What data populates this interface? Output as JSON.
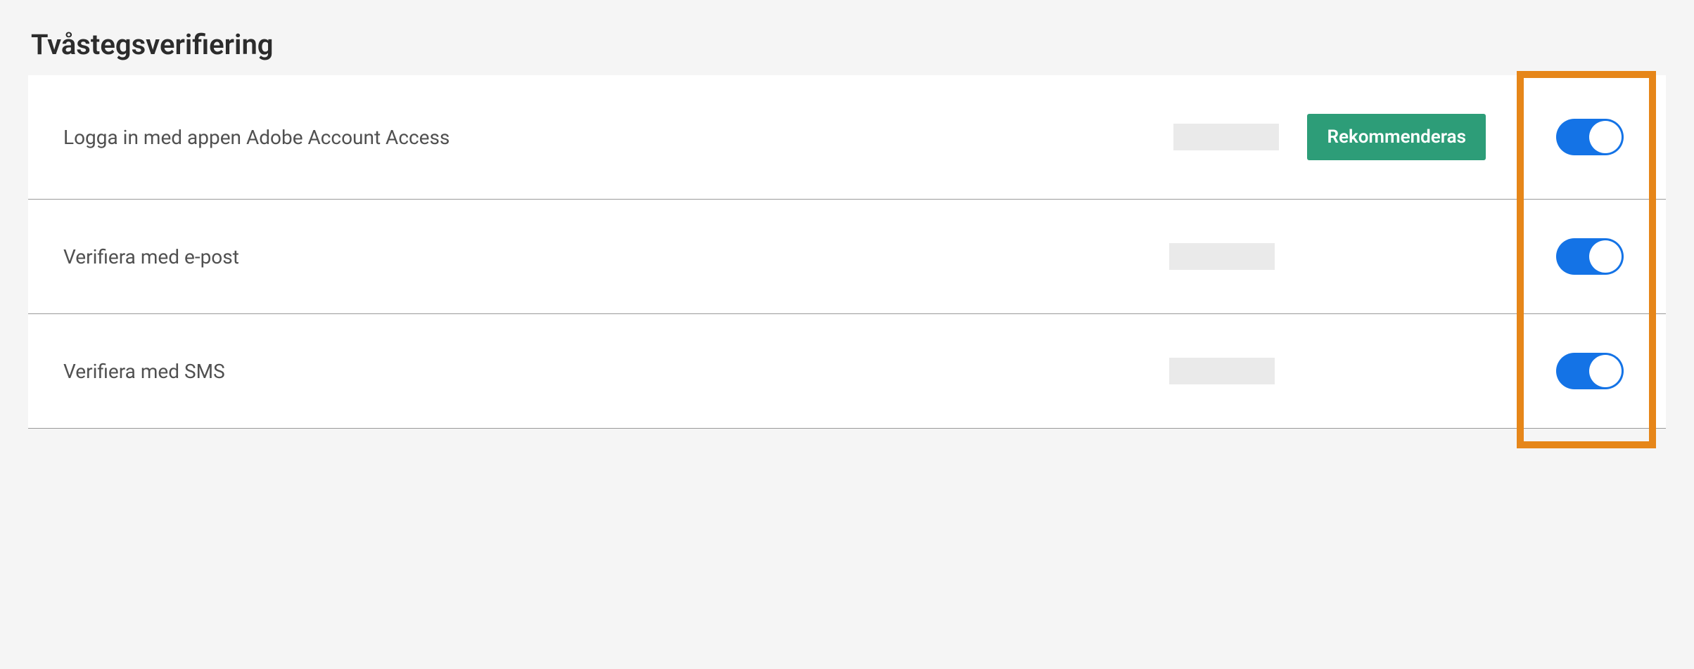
{
  "section": {
    "title": "Tvåstegsverifiering"
  },
  "settings": [
    {
      "label": "Logga in med appen Adobe Account Access",
      "badge": "Rekommenderas",
      "toggled": true
    },
    {
      "label": "Verifiera med e-post",
      "badge": null,
      "toggled": true
    },
    {
      "label": "Verifiera med SMS",
      "badge": null,
      "toggled": true
    }
  ]
}
